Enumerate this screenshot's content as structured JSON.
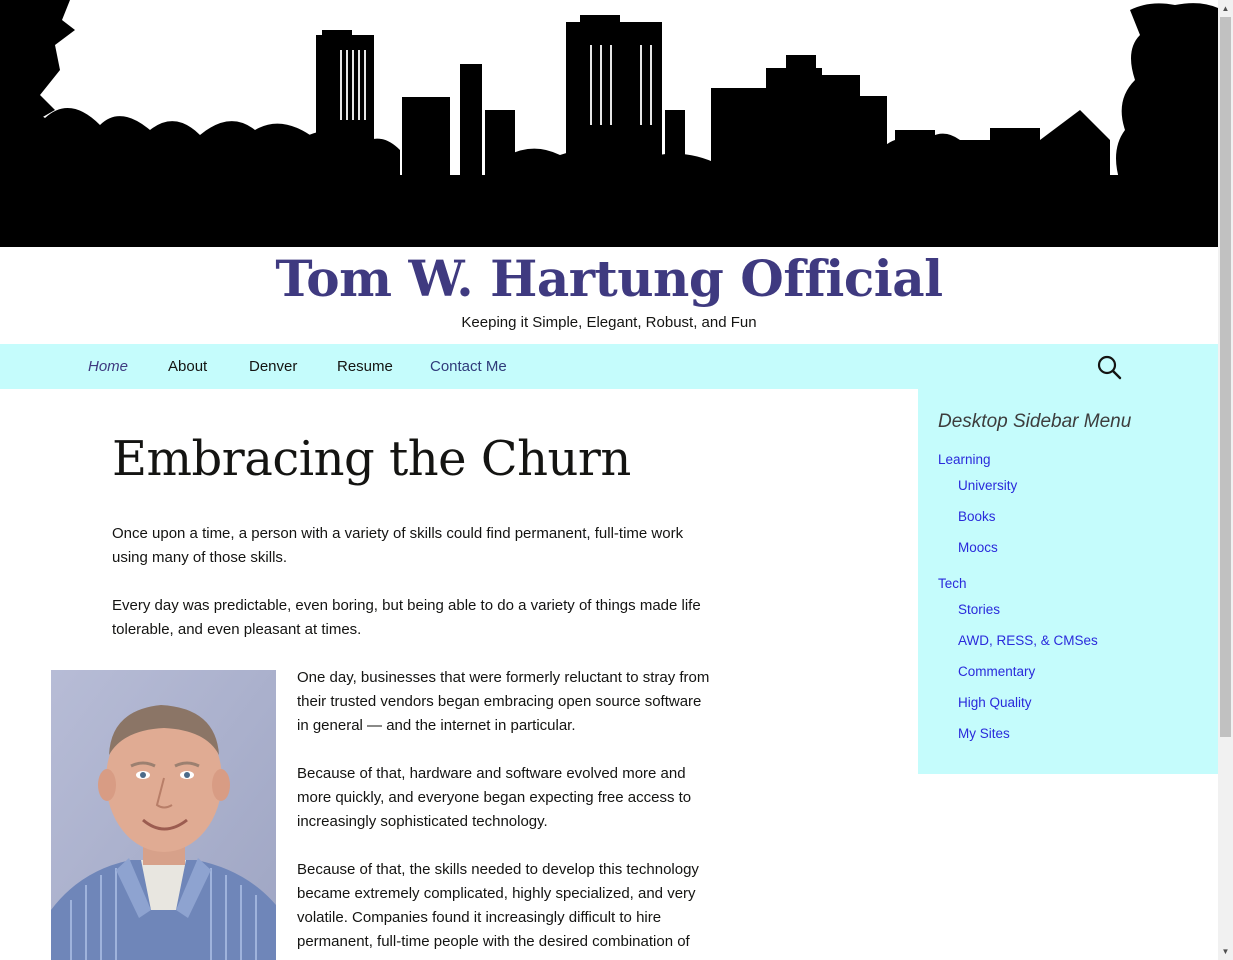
{
  "site": {
    "title": "Tom W. Hartung Official",
    "tagline": "Keeping it Simple, Elegant, Robust, and Fun"
  },
  "nav": {
    "items": [
      {
        "label": "Home",
        "current": true
      },
      {
        "label": "About"
      },
      {
        "label": "Denver"
      },
      {
        "label": "Resume"
      },
      {
        "label": "Contact Me"
      }
    ],
    "search_icon": "search-icon"
  },
  "post": {
    "title": "Embracing the Churn",
    "paragraphs": [
      "Once upon a time, a person with a variety of skills could find permanent, full-time work using many of those skills.",
      "Every day was predictable, even boring, but being able to do a variety of things made life tolerable, and even pleasant at times.",
      "One day, businesses that were formerly reluctant to stray from their trusted vendors began embracing open source software in general — and the internet in particular.",
      "Because of that, hardware and software evolved more and more quickly, and everyone began expecting free access to increasingly sophisticated technology.",
      "Because of that, the skills needed to develop this technology became extremely complicated, highly specialized, and very volatile. Companies found it increasingly difficult to hire permanent, full-time people with the desired combination of"
    ]
  },
  "sidebar": {
    "title": "Desktop Sidebar Menu",
    "groups": [
      {
        "label": "Learning",
        "items": [
          "University",
          "Books",
          "Moocs"
        ]
      },
      {
        "label": "Tech",
        "items": [
          "Stories",
          "AWD, RESS, & CMSes",
          "Commentary",
          "High Quality",
          "My Sites"
        ]
      }
    ]
  },
  "colors": {
    "accent": "#3f3a80",
    "nav_bg": "#c5fcfc",
    "sidebar_link": "#2a2adb"
  }
}
